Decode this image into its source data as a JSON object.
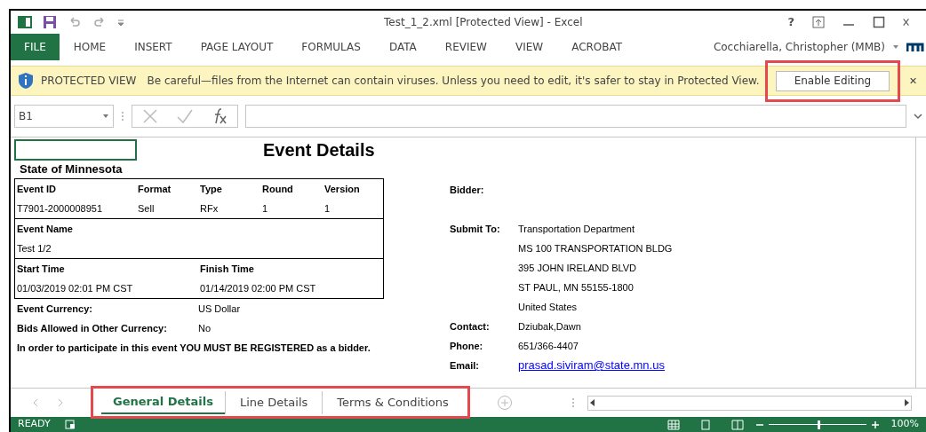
{
  "window": {
    "title": "Test_1_2.xml  [Protected View] - Excel",
    "help": "?"
  },
  "ribbon": {
    "tabs": [
      {
        "label": "FILE",
        "selected": true
      },
      {
        "label": "HOME",
        "selected": false
      },
      {
        "label": "INSERT",
        "selected": false
      },
      {
        "label": "PAGE LAYOUT",
        "selected": false
      },
      {
        "label": "FORMULAS",
        "selected": false
      },
      {
        "label": "DATA",
        "selected": false
      },
      {
        "label": "REVIEW",
        "selected": false
      },
      {
        "label": "VIEW",
        "selected": false
      },
      {
        "label": "ACROBAT",
        "selected": false
      }
    ],
    "user": "Cocchiarella, Christopher (MMB)"
  },
  "protected_bar": {
    "title": "PROTECTED VIEW",
    "message": "Be careful—files from the Internet can contain viruses. Unless you need to edit, it's safer to stay in Protected View.",
    "button": "Enable Editing"
  },
  "formula_bar": {
    "name_box": "B1"
  },
  "sheet": {
    "title": "Event Details",
    "organization": "State of Minnesota",
    "id_headers": [
      "Event ID",
      "Format",
      "Type",
      "Round",
      "Version"
    ],
    "id_values": [
      "T7901-2000008951",
      "Sell",
      "RFx",
      "1",
      "1"
    ],
    "name_header": "Event Name",
    "name_value": "Test 1/2",
    "time_headers": [
      "Start Time",
      "Finish Time"
    ],
    "time_values": [
      "01/03/2019 02:01 PM CST",
      "01/14/2019 02:00 PM CST"
    ],
    "info": [
      {
        "label": "Event Currency:",
        "value": "US Dollar"
      },
      {
        "label": "Bids Allowed in Other Currency:",
        "value": "No"
      }
    ],
    "notice": "In order to participate in this event YOU MUST BE REGISTERED as a bidder.",
    "bidder_label": "Bidder:",
    "submit_label": "Submit To:",
    "submit_lines": [
      "Transportation Department",
      "MS 100 TRANSPORTATION BLDG",
      "395 JOHN IRELAND BLVD",
      "ST PAUL, MN 55155-1800",
      "United States"
    ],
    "contacts": [
      {
        "label": "Contact:",
        "value": "Dziubak,Dawn",
        "kind": "text"
      },
      {
        "label": "Phone:",
        "value": "651/366-4407",
        "kind": "text"
      },
      {
        "label": "Email:",
        "value": "prasad.siviram@state.mn.us",
        "kind": "link"
      }
    ]
  },
  "sheet_tabs": [
    {
      "label": "General Details",
      "selected": true
    },
    {
      "label": "Line Details",
      "selected": false
    },
    {
      "label": "Terms & Conditions",
      "selected": false
    }
  ],
  "status_bar": {
    "status": "READY",
    "zoom": {
      "level": 0.5
    },
    "zoom_label": "100%"
  }
}
